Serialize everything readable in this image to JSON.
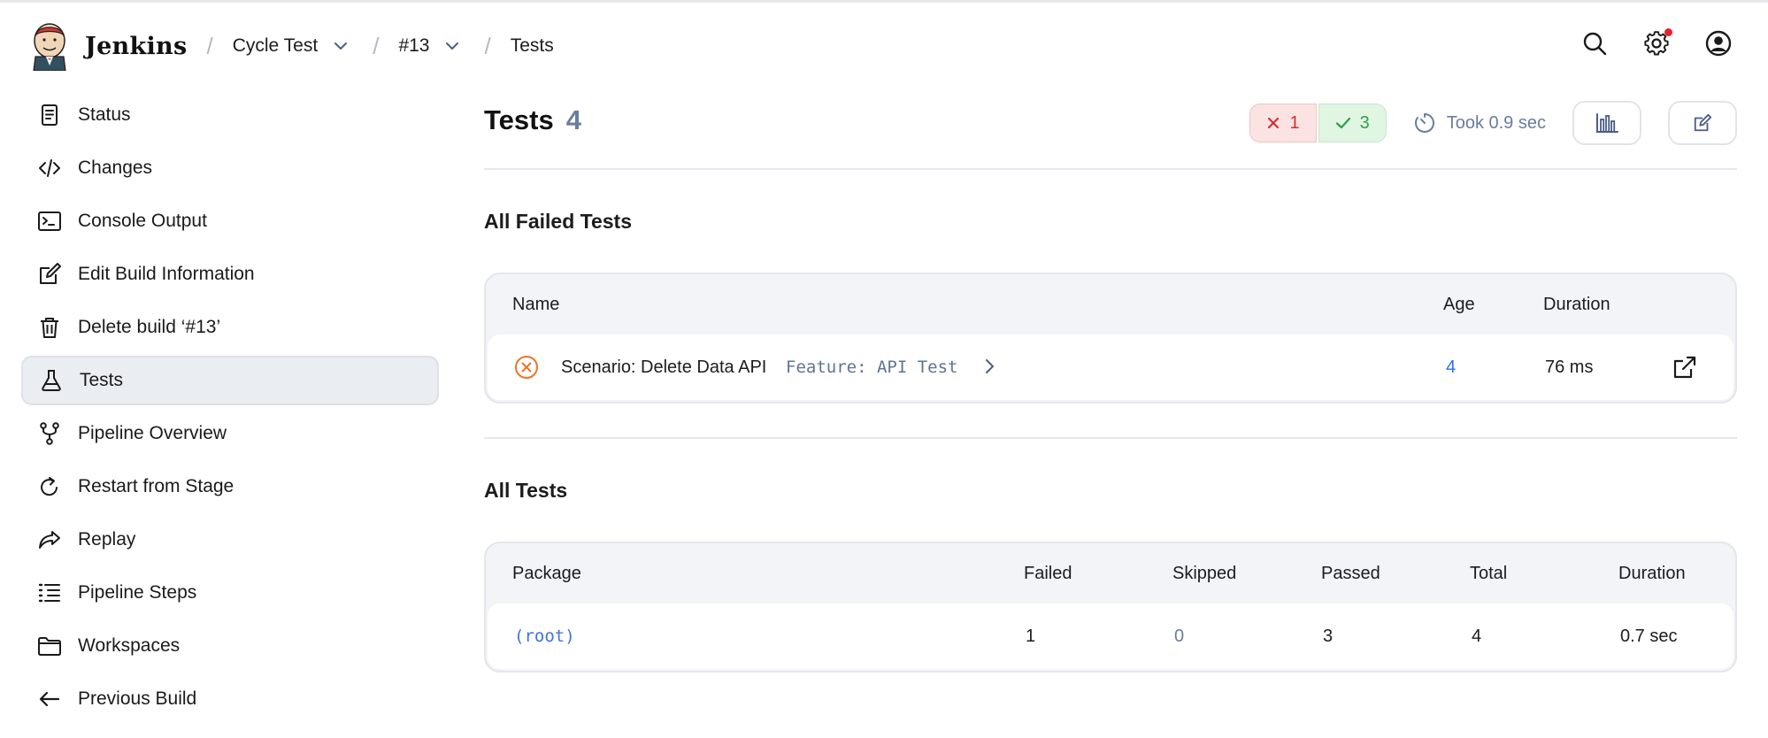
{
  "header": {
    "brand": "Jenkins",
    "breadcrumb": [
      {
        "label": "Cycle Test",
        "has_dropdown": true
      },
      {
        "label": "#13",
        "has_dropdown": true
      },
      {
        "label": "Tests",
        "has_dropdown": false
      }
    ],
    "icons": [
      "search-icon",
      "gear-icon",
      "user-icon"
    ],
    "notification_color": "#e5222f"
  },
  "sidebar": {
    "items": [
      {
        "label": "Status",
        "icon": "status-icon",
        "active": false
      },
      {
        "label": "Changes",
        "icon": "code-icon",
        "active": false
      },
      {
        "label": "Console Output",
        "icon": "terminal-icon",
        "active": false
      },
      {
        "label": "Edit Build Information",
        "icon": "edit-icon",
        "active": false
      },
      {
        "label": "Delete build ‘#13’",
        "icon": "trash-icon",
        "active": false
      },
      {
        "label": "Tests",
        "icon": "flask-icon",
        "active": true
      },
      {
        "label": "Pipeline Overview",
        "icon": "branch-icon",
        "active": false
      },
      {
        "label": "Restart from Stage",
        "icon": "restart-icon",
        "active": false
      },
      {
        "label": "Replay",
        "icon": "replay-icon",
        "active": false
      },
      {
        "label": "Pipeline Steps",
        "icon": "steps-icon",
        "active": false
      },
      {
        "label": "Workspaces",
        "icon": "folder-icon",
        "active": false
      },
      {
        "label": "Previous Build",
        "icon": "arrow-left-icon",
        "active": false
      }
    ]
  },
  "main": {
    "title": "Tests",
    "count": "4",
    "summary": {
      "failed": "1",
      "passed": "3",
      "took": "Took 0.9 sec"
    },
    "failed_section": {
      "title": "All Failed Tests",
      "columns": {
        "name": "Name",
        "age": "Age",
        "duration": "Duration"
      },
      "rows": [
        {
          "name": "Scenario: Delete Data API",
          "feature": "Feature: API Test",
          "age": "4",
          "duration": "76 ms"
        }
      ]
    },
    "all_section": {
      "title": "All Tests",
      "columns": {
        "package": "Package",
        "failed": "Failed",
        "skipped": "Skipped",
        "passed": "Passed",
        "total": "Total",
        "duration": "Duration"
      },
      "rows": [
        {
          "package": "(root)",
          "failed": "1",
          "skipped": "0",
          "passed": "3",
          "total": "4",
          "duration": "0.7 sec"
        }
      ]
    }
  },
  "colors": {
    "fail": "#d52e2e",
    "pass": "#2f9e4a",
    "link": "#2f6fde",
    "muted": "#6a7d9c",
    "warning": "#e8742c"
  }
}
